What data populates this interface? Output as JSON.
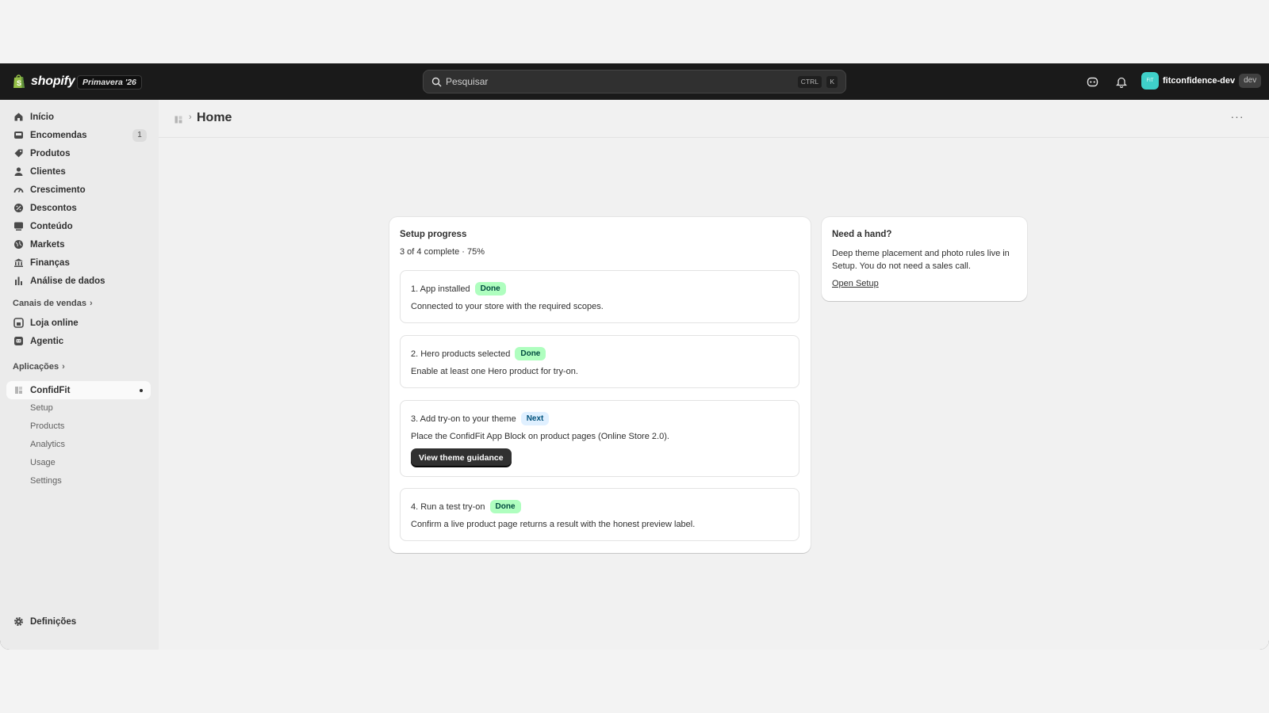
{
  "topbar": {
    "logo_text": "shopify",
    "edition": "Primavera '26",
    "search_placeholder": "Pesquisar",
    "shortcut_ctrl": "CTRL",
    "shortcut_k": "K",
    "store_avatar": "FIT",
    "store_name": "fitconfidence-dev",
    "store_badge": "dev",
    "icons": [
      "shopify-bag-icon",
      "search-icon",
      "sidekick-icon",
      "bell-icon"
    ]
  },
  "sidebar": {
    "items": [
      {
        "label": "Início",
        "icon": "home-icon"
      },
      {
        "label": "Encomendas",
        "icon": "inbox-icon",
        "count": "1"
      },
      {
        "label": "Produtos",
        "icon": "tag-icon"
      },
      {
        "label": "Clientes",
        "icon": "person-icon"
      },
      {
        "label": "Crescimento",
        "icon": "gauge-icon"
      },
      {
        "label": "Descontos",
        "icon": "discount-icon"
      },
      {
        "label": "Conteúdo",
        "icon": "content-icon"
      },
      {
        "label": "Markets",
        "icon": "globe-icon"
      },
      {
        "label": "Finanças",
        "icon": "bank-icon"
      },
      {
        "label": "Análise de dados",
        "icon": "bar-chart-icon"
      }
    ],
    "sales_channels_label": "Canais de vendas",
    "sales_channels": [
      {
        "label": "Loja online",
        "icon": "store-icon"
      },
      {
        "label": "Agentic",
        "icon": "agentic-icon"
      }
    ],
    "apps_label": "Aplicações",
    "app": {
      "label": "ConfidFit",
      "icon": "app-icon"
    },
    "app_sub": [
      "Setup",
      "Products",
      "Analytics",
      "Usage",
      "Settings"
    ],
    "settings_label": "Definições"
  },
  "main": {
    "breadcrumb_title": "Home",
    "more_label": "···",
    "setup": {
      "title": "Setup progress",
      "progress_text": "3 of 4 complete · 75%",
      "progress_fraction": 0.75,
      "steps": [
        {
          "title": "1. App installed",
          "status": "Done",
          "desc": "Connected to your store with the required scopes."
        },
        {
          "title": "2. Hero products selected",
          "status": "Done",
          "desc": "Enable at least one Hero product for try-on."
        },
        {
          "title": "3. Add try-on to your theme",
          "status": "Next",
          "desc": "Place the ConfidFit App Block on product pages (Online Store 2.0).",
          "button": "View theme guidance"
        },
        {
          "title": "4. Run a test try-on",
          "status": "Done",
          "desc": "Confirm a live product page returns a result with the honest preview label."
        }
      ]
    },
    "help": {
      "title": "Need a hand?",
      "text": "Deep theme placement and photo rules live in Setup. You do not need a sales call.",
      "link": "Open Setup"
    }
  },
  "colors": {
    "topbar_bg": "#1a1a1a",
    "sidebar_bg": "#ebebeb",
    "main_bg": "#f1f1f1",
    "done_badge": "#affebf",
    "next_badge": "#e0f0ff",
    "primary_button": "#303030",
    "store_avatar": "#3fd0c9"
  }
}
